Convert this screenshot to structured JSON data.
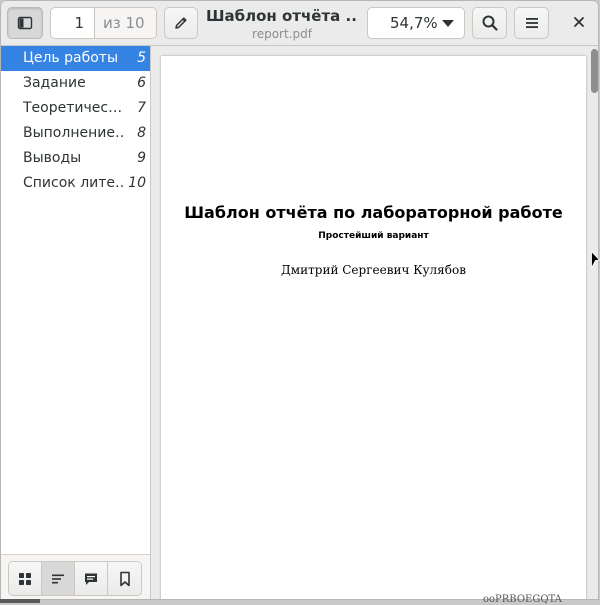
{
  "header": {
    "current_page": "1",
    "total_pages": "из 10",
    "doc_title": "Шаблон отчёта ...",
    "filename": "report.pdf",
    "zoom": "54,7%"
  },
  "toc": [
    {
      "label": "Цель работы",
      "page": "5",
      "selected": true
    },
    {
      "label": "Задание",
      "page": "6",
      "selected": false
    },
    {
      "label": "Теоретичес…",
      "page": "7",
      "selected": false
    },
    {
      "label": "Выполнение…",
      "page": "8",
      "selected": false
    },
    {
      "label": "Выводы",
      "page": "9",
      "selected": false
    },
    {
      "label": "Список лите…",
      "page": "10",
      "selected": false
    }
  ],
  "document": {
    "title": "Шаблон отчёта по лабораторной работе",
    "subtitle": "Простейший вариант",
    "author": "Дмитрий Сергеевич Кулябов"
  },
  "background": {
    "partial_text": "ooPRBOEGQTA"
  },
  "colors": {
    "accent": "#3584e4",
    "headerbar": "#ebebeb",
    "text": "#2e3436"
  }
}
